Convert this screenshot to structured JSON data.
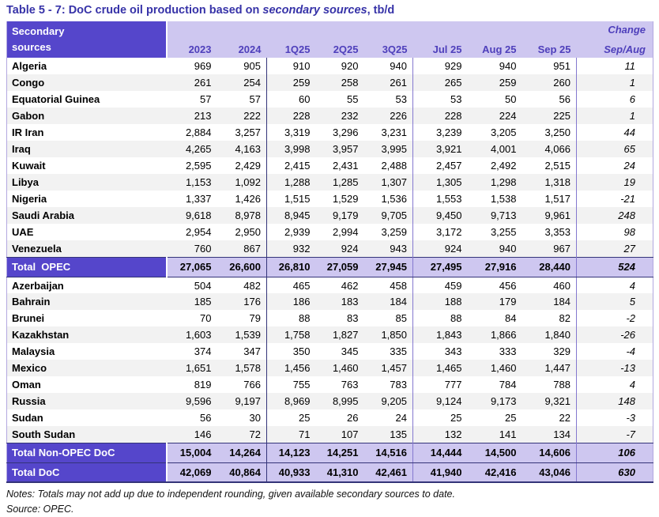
{
  "title": {
    "prefix": "Table 5 - 7: DoC crude oil production based on ",
    "italic": "secondary sources",
    "suffix": ", tb/d"
  },
  "table": {
    "row_header": {
      "line1": "Secondary",
      "line2": "sources"
    },
    "columns": [
      "2023",
      "2024",
      "1Q25",
      "2Q25",
      "3Q25",
      "Jul 25",
      "Aug 25",
      "Sep 25"
    ],
    "change_header": {
      "line1": "Change",
      "line2": "Sep/Aug"
    },
    "rows": [
      {
        "label": "Algeria",
        "type": "data",
        "values": [
          "969",
          "905",
          "910",
          "920",
          "940",
          "929",
          "940",
          "951"
        ],
        "change": "11"
      },
      {
        "label": "Congo",
        "type": "data",
        "values": [
          "261",
          "254",
          "259",
          "258",
          "261",
          "265",
          "259",
          "260"
        ],
        "change": "1"
      },
      {
        "label": "Equatorial Guinea",
        "type": "data",
        "values": [
          "57",
          "57",
          "60",
          "55",
          "53",
          "53",
          "50",
          "56"
        ],
        "change": "6"
      },
      {
        "label": "Gabon",
        "type": "data",
        "values": [
          "213",
          "222",
          "228",
          "232",
          "226",
          "228",
          "224",
          "225"
        ],
        "change": "1"
      },
      {
        "label": "IR Iran",
        "type": "data",
        "values": [
          "2,884",
          "3,257",
          "3,319",
          "3,296",
          "3,231",
          "3,239",
          "3,205",
          "3,250"
        ],
        "change": "44"
      },
      {
        "label": "Iraq",
        "type": "data",
        "values": [
          "4,265",
          "4,163",
          "3,998",
          "3,957",
          "3,995",
          "3,921",
          "4,001",
          "4,066"
        ],
        "change": "65"
      },
      {
        "label": "Kuwait",
        "type": "data",
        "values": [
          "2,595",
          "2,429",
          "2,415",
          "2,431",
          "2,488",
          "2,457",
          "2,492",
          "2,515"
        ],
        "change": "24"
      },
      {
        "label": "Libya",
        "type": "data",
        "values": [
          "1,153",
          "1,092",
          "1,288",
          "1,285",
          "1,307",
          "1,305",
          "1,298",
          "1,318"
        ],
        "change": "19"
      },
      {
        "label": "Nigeria",
        "type": "data",
        "values": [
          "1,337",
          "1,426",
          "1,515",
          "1,529",
          "1,536",
          "1,553",
          "1,538",
          "1,517"
        ],
        "change": "-21"
      },
      {
        "label": "Saudi Arabia",
        "type": "data",
        "values": [
          "9,618",
          "8,978",
          "8,945",
          "9,179",
          "9,705",
          "9,450",
          "9,713",
          "9,961"
        ],
        "change": "248"
      },
      {
        "label": "UAE",
        "type": "data",
        "values": [
          "2,954",
          "2,950",
          "2,939",
          "2,994",
          "3,259",
          "3,172",
          "3,255",
          "3,353"
        ],
        "change": "98"
      },
      {
        "label": "Venezuela",
        "type": "data",
        "values": [
          "760",
          "867",
          "932",
          "924",
          "943",
          "924",
          "940",
          "967"
        ],
        "change": "27"
      },
      {
        "label": "Total  OPEC",
        "type": "total",
        "values": [
          "27,065",
          "26,600",
          "26,810",
          "27,059",
          "27,945",
          "27,495",
          "27,916",
          "28,440"
        ],
        "change": "524"
      },
      {
        "label": "Azerbaijan",
        "type": "data",
        "values": [
          "504",
          "482",
          "465",
          "462",
          "458",
          "459",
          "456",
          "460"
        ],
        "change": "4"
      },
      {
        "label": "Bahrain",
        "type": "data",
        "values": [
          "185",
          "176",
          "186",
          "183",
          "184",
          "188",
          "179",
          "184"
        ],
        "change": "5"
      },
      {
        "label": "Brunei",
        "type": "data",
        "values": [
          "70",
          "79",
          "88",
          "83",
          "85",
          "88",
          "84",
          "82"
        ],
        "change": "-2"
      },
      {
        "label": "Kazakhstan",
        "type": "data",
        "values": [
          "1,603",
          "1,539",
          "1,758",
          "1,827",
          "1,850",
          "1,843",
          "1,866",
          "1,840"
        ],
        "change": "-26"
      },
      {
        "label": "Malaysia",
        "type": "data",
        "values": [
          "374",
          "347",
          "350",
          "345",
          "335",
          "343",
          "333",
          "329"
        ],
        "change": "-4"
      },
      {
        "label": "Mexico",
        "type": "data",
        "values": [
          "1,651",
          "1,578",
          "1,456",
          "1,460",
          "1,457",
          "1,465",
          "1,460",
          "1,447"
        ],
        "change": "-13"
      },
      {
        "label": "Oman",
        "type": "data",
        "values": [
          "819",
          "766",
          "755",
          "763",
          "783",
          "777",
          "784",
          "788"
        ],
        "change": "4"
      },
      {
        "label": "Russia",
        "type": "data",
        "values": [
          "9,596",
          "9,197",
          "8,969",
          "8,995",
          "9,205",
          "9,124",
          "9,173",
          "9,321"
        ],
        "change": "148"
      },
      {
        "label": "Sudan",
        "type": "data",
        "values": [
          "56",
          "30",
          "25",
          "26",
          "24",
          "25",
          "25",
          "22"
        ],
        "change": "-3"
      },
      {
        "label": "South Sudan",
        "type": "data",
        "values": [
          "146",
          "72",
          "71",
          "107",
          "135",
          "132",
          "141",
          "134"
        ],
        "change": "-7"
      },
      {
        "label": "Total Non-OPEC DoC",
        "type": "total",
        "values": [
          "15,004",
          "14,264",
          "14,123",
          "14,251",
          "14,516",
          "14,444",
          "14,500",
          "14,606"
        ],
        "change": "106"
      },
      {
        "label": "Total DoC",
        "type": "total",
        "values": [
          "42,069",
          "40,864",
          "40,933",
          "41,310",
          "42,461",
          "41,940",
          "42,416",
          "43,046"
        ],
        "change": "630"
      }
    ]
  },
  "footer": {
    "notes": "Notes: Totals may not add up due to independent rounding, given available secondary sources to date.",
    "source": "Source: OPEC."
  },
  "colors": {
    "header_purple": "#5546cb",
    "light_purple": "#cec7f0",
    "accent_text": "#4e3fbb",
    "title": "#3733a8",
    "dark_border": "#343479",
    "separator_purple": "#8478cf",
    "stripe_gray": "#f2f2f2"
  }
}
